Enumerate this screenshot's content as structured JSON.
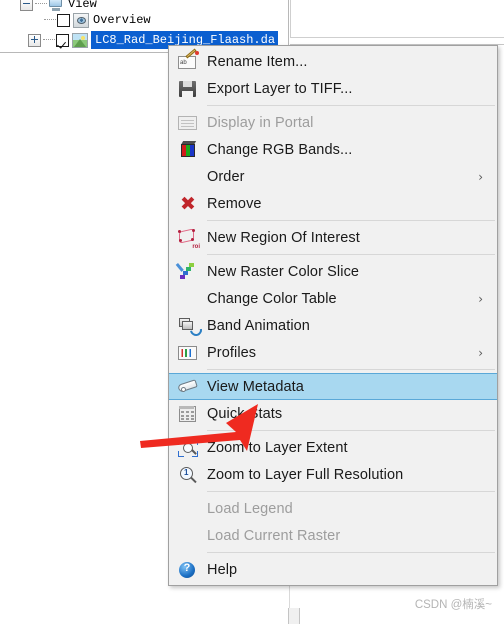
{
  "layer_tree": {
    "items": [
      {
        "label": "View",
        "icon": "monitor-icon",
        "expander": "minus",
        "checkbox": null,
        "selected": false
      },
      {
        "label": "Overview",
        "icon": "eye-icon",
        "expander": null,
        "checkbox": "unchecked",
        "selected": false
      },
      {
        "label": "LC8_Rad_Beijing_Flaash.da",
        "icon": "raster-icon",
        "expander": "plus",
        "checkbox": "checked",
        "selected": true
      }
    ],
    "selection_color": "#0b5fd0"
  },
  "context_menu": {
    "highlight_color": "#a8d8f0",
    "groups": [
      {
        "items": [
          {
            "label": "Rename Item...",
            "icon": "rename-icon",
            "disabled": false,
            "submenu": false,
            "selected": false
          },
          {
            "label": "Export Layer to TIFF...",
            "icon": "save-icon",
            "disabled": false,
            "submenu": false,
            "selected": false
          }
        ]
      },
      {
        "items": [
          {
            "label": "Display in Portal",
            "icon": "portal-icon",
            "disabled": true,
            "submenu": false,
            "selected": false
          },
          {
            "label": "Change RGB Bands...",
            "icon": "rgb-cube-icon",
            "disabled": false,
            "submenu": false,
            "selected": false
          },
          {
            "label": "Order",
            "icon": null,
            "disabled": false,
            "submenu": true,
            "selected": false
          },
          {
            "label": "Remove",
            "icon": "x-icon",
            "disabled": false,
            "submenu": false,
            "selected": false
          }
        ]
      },
      {
        "items": [
          {
            "label": "New Region Of Interest",
            "icon": "roi-icon",
            "disabled": false,
            "submenu": false,
            "selected": false
          }
        ]
      },
      {
        "items": [
          {
            "label": "New Raster Color Slice",
            "icon": "color-slice-icon",
            "disabled": false,
            "submenu": false,
            "selected": false
          },
          {
            "label": "Change Color Table",
            "icon": null,
            "disabled": false,
            "submenu": true,
            "selected": false
          },
          {
            "label": "Band Animation",
            "icon": "band-animation-icon",
            "disabled": false,
            "submenu": false,
            "selected": false
          },
          {
            "label": "Profiles",
            "icon": "profiles-icon",
            "disabled": false,
            "submenu": true,
            "selected": false
          }
        ]
      },
      {
        "items": [
          {
            "label": "View Metadata",
            "icon": "metadata-tag-icon",
            "disabled": false,
            "submenu": false,
            "selected": true
          },
          {
            "label": "Quick Stats",
            "icon": "quick-stats-icon",
            "disabled": false,
            "submenu": false,
            "selected": false
          }
        ]
      },
      {
        "items": [
          {
            "label": "Zoom to Layer Extent",
            "icon": "zoom-extent-icon",
            "disabled": false,
            "submenu": false,
            "selected": false
          },
          {
            "label": "Zoom to Layer Full Resolution",
            "icon": "zoom-full-resolution-icon",
            "disabled": false,
            "submenu": false,
            "selected": false
          }
        ]
      },
      {
        "items": [
          {
            "label": "Load Legend",
            "icon": null,
            "disabled": true,
            "submenu": false,
            "selected": false
          },
          {
            "label": "Load Current Raster",
            "icon": null,
            "disabled": true,
            "submenu": false,
            "selected": false
          }
        ]
      },
      {
        "items": [
          {
            "label": "Help",
            "icon": "help-icon",
            "disabled": false,
            "submenu": false,
            "selected": false
          }
        ]
      }
    ],
    "submenu_glyph": "›"
  },
  "annotation": {
    "arrow_color": "#ef2a20",
    "points_to": "View Metadata"
  },
  "watermark": {
    "text": "CSDN @楠溪~"
  }
}
